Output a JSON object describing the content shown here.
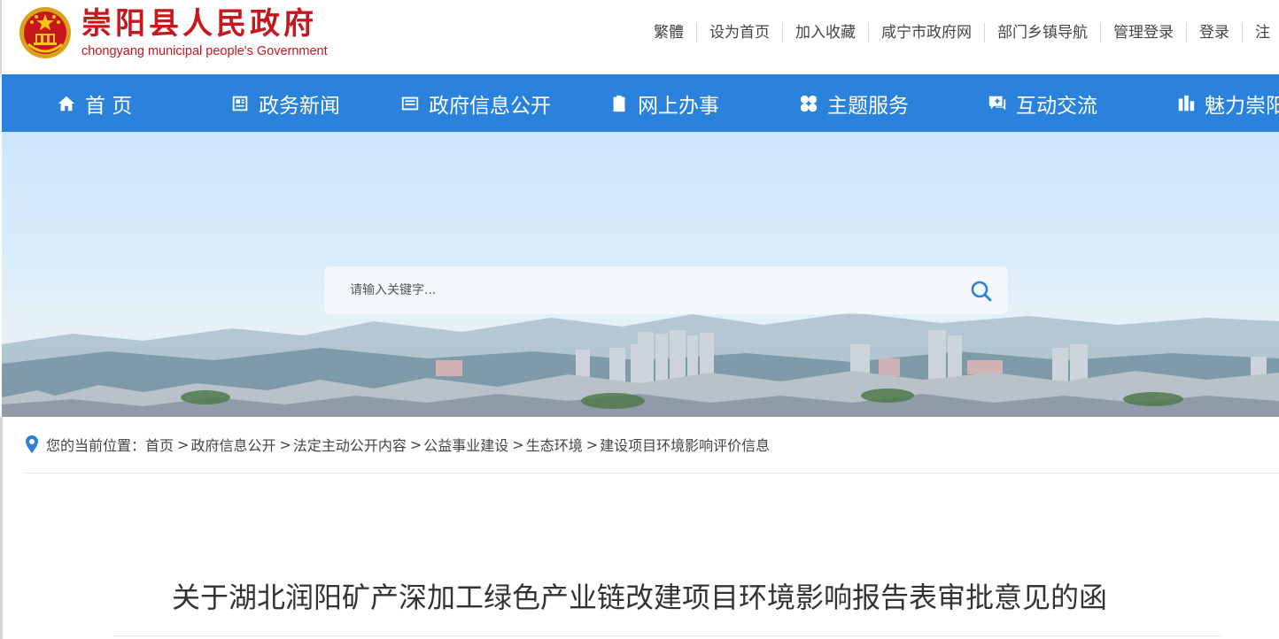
{
  "header": {
    "site_name_cn": "崇阳县人民政府",
    "site_name_en": "chongyang municipal people's Government",
    "top_links": [
      "繁體",
      "设为首页",
      "加入收藏",
      "咸宁市政府网",
      "部门乡镇导航",
      "管理登录",
      "登录",
      "注"
    ]
  },
  "nav": {
    "items": [
      {
        "label": "首 页",
        "icon": "home-icon"
      },
      {
        "label": "政务新闻",
        "icon": "newspaper-icon"
      },
      {
        "label": "政府信息公开",
        "icon": "document-icon"
      },
      {
        "label": "网上办事",
        "icon": "clipboard-check-icon"
      },
      {
        "label": "主题服务",
        "icon": "grid-icon"
      },
      {
        "label": "互动交流",
        "icon": "chat-icon"
      },
      {
        "label": "魅力崇阳",
        "icon": "building-icon"
      }
    ]
  },
  "search": {
    "placeholder": "请输入关键字..."
  },
  "breadcrumb": {
    "prefix": "您的当前位置：",
    "items": [
      "首页",
      "政府信息公开",
      "法定主动公开内容",
      "公益事业建设",
      "生态环境",
      "建设项目环境影响评价信息"
    ]
  },
  "article": {
    "title": "关于湖北润阳矿产深加工绿色产业链改建项目环境影响报告表审批意见的函"
  },
  "colors": {
    "brand_red": "#c8161d",
    "nav_blue": "#2a82dc",
    "location_pin": "#2a82dc"
  }
}
